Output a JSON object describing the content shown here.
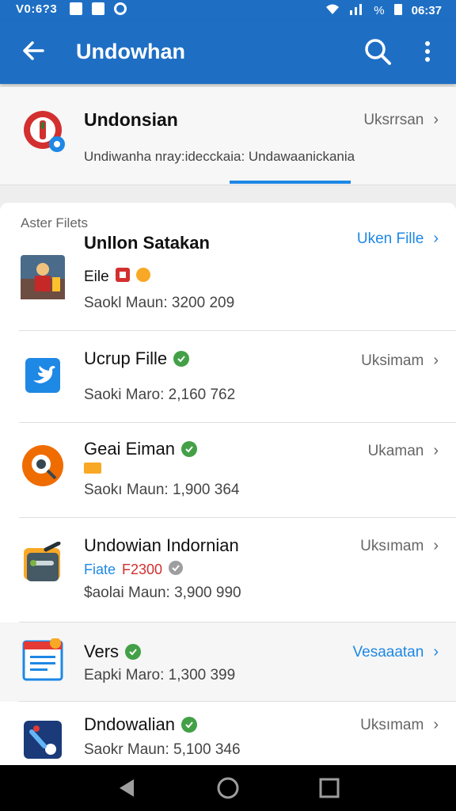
{
  "status_bar": {
    "time": "V0:6?3",
    "clock": "06:37",
    "battery": "%"
  },
  "app_bar": {
    "title": "Undowhan"
  },
  "header": {
    "title": "Undonsian",
    "action": "Uksrrsan",
    "description": "Undiwanha nray:idecckaia: Undawaanickania"
  },
  "section": {
    "title": "Aster Filets"
  },
  "items": [
    {
      "name": "Unllon Satakan",
      "sub": "Eile",
      "meta": "Saokl Maun: 3200 209",
      "action": "Uken Fille",
      "action_style": "blue"
    },
    {
      "name": "Ucrup Fille",
      "meta": "Saoki Maro: 2,160 762",
      "action": "Uksimam"
    },
    {
      "name": "Geai Eiman",
      "meta": "Saokı Maun: 1,900 364",
      "action": "Ukaman"
    },
    {
      "name": "Undowian Indornian",
      "sub_blue": "Fiate",
      "sub_red": "F2300",
      "meta": "$aolai Maun: 3,900 990",
      "action": "Uksımam"
    },
    {
      "name": "Vers",
      "meta": "Eapki Maro: 1,300 399",
      "action": "Vesaaatan",
      "action_style": "blue"
    },
    {
      "name": "Dndowalian",
      "meta": "Saokr Maun: 5,100 346",
      "action": "Uksımam"
    }
  ],
  "colors": {
    "primary": "#1e6fc4",
    "accent": "#1e88e5",
    "success": "#43a047"
  }
}
